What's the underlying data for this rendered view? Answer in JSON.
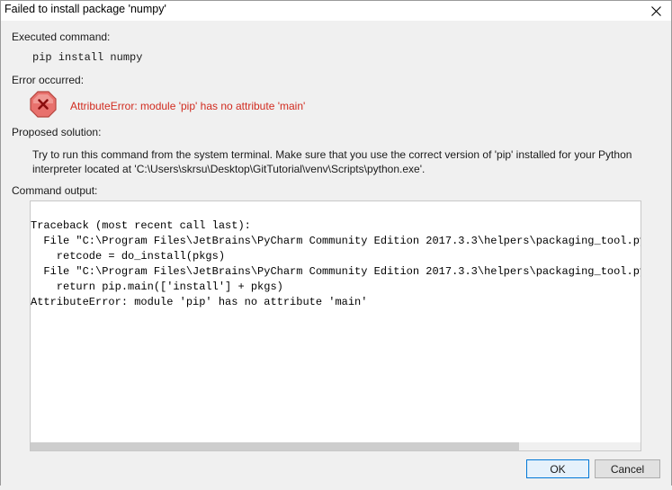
{
  "dialog": {
    "title": "Failed to install package 'numpy'",
    "executed_label": "Executed command:",
    "command": "pip install numpy",
    "error_label": "Error occurred:",
    "error_message": "AttributeError: module 'pip' has no attribute 'main'",
    "solution_label": "Proposed solution:",
    "solution_text": "Try to run this command from the system terminal. Make sure that you use the correct version of 'pip' installed for your Python interpreter located at 'C:\\Users\\skrsu\\Desktop\\GitTutorial\\venv\\Scripts\\python.exe'.",
    "output_label": "Command output:",
    "output_text": "Traceback (most recent call last):\n  File \"C:\\Program Files\\JetBrains\\PyCharm Community Edition 2017.3.3\\helpers\\packaging_tool.py\",\n    retcode = do_install(pkgs)\n  File \"C:\\Program Files\\JetBrains\\PyCharm Community Edition 2017.3.3\\helpers\\packaging_tool.py\",\n    return pip.main(['install'] + pkgs)\nAttributeError: module 'pip' has no attribute 'main'",
    "ok_label": "OK",
    "cancel_label": "Cancel"
  },
  "icons": {
    "close": "close-icon",
    "error": "error-octagon-icon"
  },
  "colors": {
    "error_text": "#d12b1f",
    "error_icon_fill": "#e8716d",
    "primary_border": "#0078d7"
  }
}
